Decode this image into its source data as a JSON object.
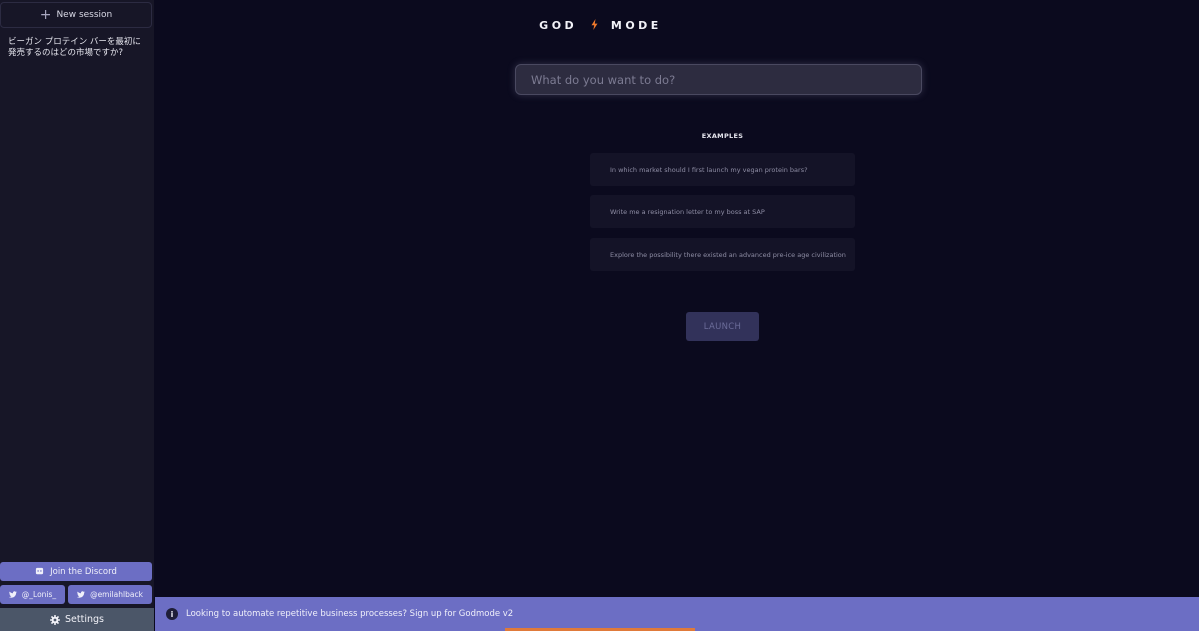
{
  "sidebar": {
    "new_session_label": "New session",
    "history": [
      "ビーガン プロテイン バーを最初に発売するのはどの市場ですか?"
    ],
    "discord_label": "Join the Discord",
    "twitter": [
      {
        "handle": "@_Lonis_"
      },
      {
        "handle": "@emilahlback"
      }
    ],
    "settings_label": "Settings"
  },
  "header": {
    "logo_left": "GOD",
    "logo_icon": "lightning-bolt-icon",
    "logo_right": "MODE",
    "accent_color": "#f07a2c"
  },
  "search": {
    "placeholder": "What do you want to do?",
    "value": ""
  },
  "examples": {
    "title": "EXAMPLES",
    "items": [
      "In which market should I first launch my vegan protein bars?",
      "Write me a resignation letter to my boss at SAP",
      "Explore the possibility there existed an advanced pre-ice age civilization"
    ]
  },
  "launch_label": "LAUNCH",
  "banner": {
    "text": "Looking to automate repetitive business processes? Sign up for Godmode v2",
    "color": "#6c6ec4"
  }
}
